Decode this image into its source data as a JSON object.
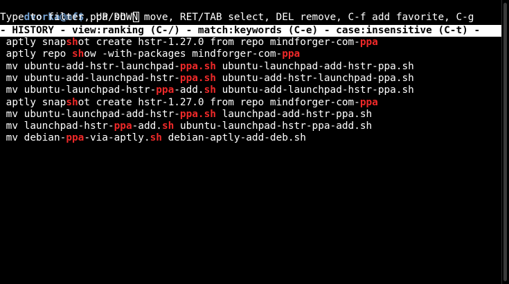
{
  "prompt": {
    "user_host": "dvorka@mf$",
    "query": "ppa sh"
  },
  "help_line": "Type to filter, UP/DOWN move, RET/TAB select, DEL remove, C-f add favorite, C-g",
  "status_line": "- HISTORY - view:ranking (C-/) - match:keywords (C-e) - case:insensitive (C-t) -",
  "colors": {
    "background": "#000000",
    "text": "#ffffff",
    "prompt": "#729fcf",
    "highlight": "#ef2929",
    "status_bg": "#ffffff",
    "status_fg": "#000000"
  },
  "history": [
    {
      "segments": [
        " aptly snap",
        "sh",
        "ot create hstr-1.27.0 from repo mindforger-com-",
        "ppa",
        ""
      ]
    },
    {
      "segments": [
        " aptly repo ",
        "sh",
        "ow -with-packages mindforger-com-",
        "ppa",
        ""
      ]
    },
    {
      "segments": [
        " mv ubuntu-add-hstr-launchpad-",
        "ppa.sh",
        " ubuntu-launchpad-add-hstr-ppa.sh",
        "",
        ""
      ]
    },
    {
      "segments": [
        " mv ubuntu-add-launchpad-hstr-",
        "ppa.sh",
        " ubuntu-add-hstr-launchpad-ppa.sh",
        "",
        ""
      ]
    },
    {
      "segments": [
        " mv ubuntu-launchpad-hstr-",
        "ppa",
        "-add.",
        "sh",
        " ubuntu-add-launchpad-hstr-ppa.sh"
      ]
    },
    {
      "segments": [
        " aptly snap",
        "sh",
        "ot create hstr-1.27.0 from repo mindforger-com-",
        "ppa",
        ""
      ]
    },
    {
      "segments": [
        " mv ubuntu-launchpad-add-hstr-",
        "ppa.sh",
        " launchpad-add-hstr-ppa.sh",
        "",
        ""
      ]
    },
    {
      "segments": [
        " mv launchpad-hstr-",
        "ppa",
        "-add.",
        "sh",
        " ubuntu-launchpad-hstr-ppa-add.sh"
      ]
    },
    {
      "segments": [
        " mv debian-",
        "ppa",
        "-via-aptly.",
        "sh",
        " debian-aptly-add-deb.sh"
      ]
    }
  ]
}
